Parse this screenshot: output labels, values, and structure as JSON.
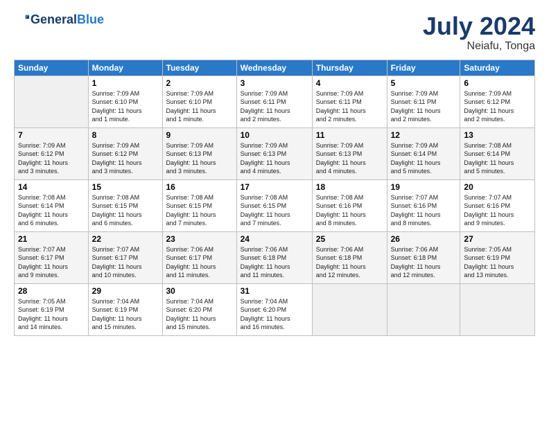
{
  "header": {
    "logo_line1": "General",
    "logo_line2": "Blue",
    "title": "July 2024",
    "subtitle": "Neiafu, Tonga"
  },
  "days_of_week": [
    "Sunday",
    "Monday",
    "Tuesday",
    "Wednesday",
    "Thursday",
    "Friday",
    "Saturday"
  ],
  "weeks": [
    [
      {
        "day": "",
        "info": ""
      },
      {
        "day": "1",
        "info": "Sunrise: 7:09 AM\nSunset: 6:10 PM\nDaylight: 11 hours\nand 1 minute."
      },
      {
        "day": "2",
        "info": "Sunrise: 7:09 AM\nSunset: 6:10 PM\nDaylight: 11 hours\nand 1 minute."
      },
      {
        "day": "3",
        "info": "Sunrise: 7:09 AM\nSunset: 6:11 PM\nDaylight: 11 hours\nand 2 minutes."
      },
      {
        "day": "4",
        "info": "Sunrise: 7:09 AM\nSunset: 6:11 PM\nDaylight: 11 hours\nand 2 minutes."
      },
      {
        "day": "5",
        "info": "Sunrise: 7:09 AM\nSunset: 6:11 PM\nDaylight: 11 hours\nand 2 minutes."
      },
      {
        "day": "6",
        "info": "Sunrise: 7:09 AM\nSunset: 6:12 PM\nDaylight: 11 hours\nand 2 minutes."
      }
    ],
    [
      {
        "day": "7",
        "info": "Sunrise: 7:09 AM\nSunset: 6:12 PM\nDaylight: 11 hours\nand 3 minutes."
      },
      {
        "day": "8",
        "info": "Sunrise: 7:09 AM\nSunset: 6:12 PM\nDaylight: 11 hours\nand 3 minutes."
      },
      {
        "day": "9",
        "info": "Sunrise: 7:09 AM\nSunset: 6:13 PM\nDaylight: 11 hours\nand 3 minutes."
      },
      {
        "day": "10",
        "info": "Sunrise: 7:09 AM\nSunset: 6:13 PM\nDaylight: 11 hours\nand 4 minutes."
      },
      {
        "day": "11",
        "info": "Sunrise: 7:09 AM\nSunset: 6:13 PM\nDaylight: 11 hours\nand 4 minutes."
      },
      {
        "day": "12",
        "info": "Sunrise: 7:09 AM\nSunset: 6:14 PM\nDaylight: 11 hours\nand 5 minutes."
      },
      {
        "day": "13",
        "info": "Sunrise: 7:08 AM\nSunset: 6:14 PM\nDaylight: 11 hours\nand 5 minutes."
      }
    ],
    [
      {
        "day": "14",
        "info": "Sunrise: 7:08 AM\nSunset: 6:14 PM\nDaylight: 11 hours\nand 6 minutes."
      },
      {
        "day": "15",
        "info": "Sunrise: 7:08 AM\nSunset: 6:15 PM\nDaylight: 11 hours\nand 6 minutes."
      },
      {
        "day": "16",
        "info": "Sunrise: 7:08 AM\nSunset: 6:15 PM\nDaylight: 11 hours\nand 7 minutes."
      },
      {
        "day": "17",
        "info": "Sunrise: 7:08 AM\nSunset: 6:15 PM\nDaylight: 11 hours\nand 7 minutes."
      },
      {
        "day": "18",
        "info": "Sunrise: 7:08 AM\nSunset: 6:16 PM\nDaylight: 11 hours\nand 8 minutes."
      },
      {
        "day": "19",
        "info": "Sunrise: 7:07 AM\nSunset: 6:16 PM\nDaylight: 11 hours\nand 8 minutes."
      },
      {
        "day": "20",
        "info": "Sunrise: 7:07 AM\nSunset: 6:16 PM\nDaylight: 11 hours\nand 9 minutes."
      }
    ],
    [
      {
        "day": "21",
        "info": "Sunrise: 7:07 AM\nSunset: 6:17 PM\nDaylight: 11 hours\nand 9 minutes."
      },
      {
        "day": "22",
        "info": "Sunrise: 7:07 AM\nSunset: 6:17 PM\nDaylight: 11 hours\nand 10 minutes."
      },
      {
        "day": "23",
        "info": "Sunrise: 7:06 AM\nSunset: 6:17 PM\nDaylight: 11 hours\nand 11 minutes."
      },
      {
        "day": "24",
        "info": "Sunrise: 7:06 AM\nSunset: 6:18 PM\nDaylight: 11 hours\nand 11 minutes."
      },
      {
        "day": "25",
        "info": "Sunrise: 7:06 AM\nSunset: 6:18 PM\nDaylight: 11 hours\nand 12 minutes."
      },
      {
        "day": "26",
        "info": "Sunrise: 7:06 AM\nSunset: 6:18 PM\nDaylight: 11 hours\nand 12 minutes."
      },
      {
        "day": "27",
        "info": "Sunrise: 7:05 AM\nSunset: 6:19 PM\nDaylight: 11 hours\nand 13 minutes."
      }
    ],
    [
      {
        "day": "28",
        "info": "Sunrise: 7:05 AM\nSunset: 6:19 PM\nDaylight: 11 hours\nand 14 minutes."
      },
      {
        "day": "29",
        "info": "Sunrise: 7:04 AM\nSunset: 6:19 PM\nDaylight: 11 hours\nand 15 minutes."
      },
      {
        "day": "30",
        "info": "Sunrise: 7:04 AM\nSunset: 6:20 PM\nDaylight: 11 hours\nand 15 minutes."
      },
      {
        "day": "31",
        "info": "Sunrise: 7:04 AM\nSunset: 6:20 PM\nDaylight: 11 hours\nand 16 minutes."
      },
      {
        "day": "",
        "info": ""
      },
      {
        "day": "",
        "info": ""
      },
      {
        "day": "",
        "info": ""
      }
    ]
  ]
}
